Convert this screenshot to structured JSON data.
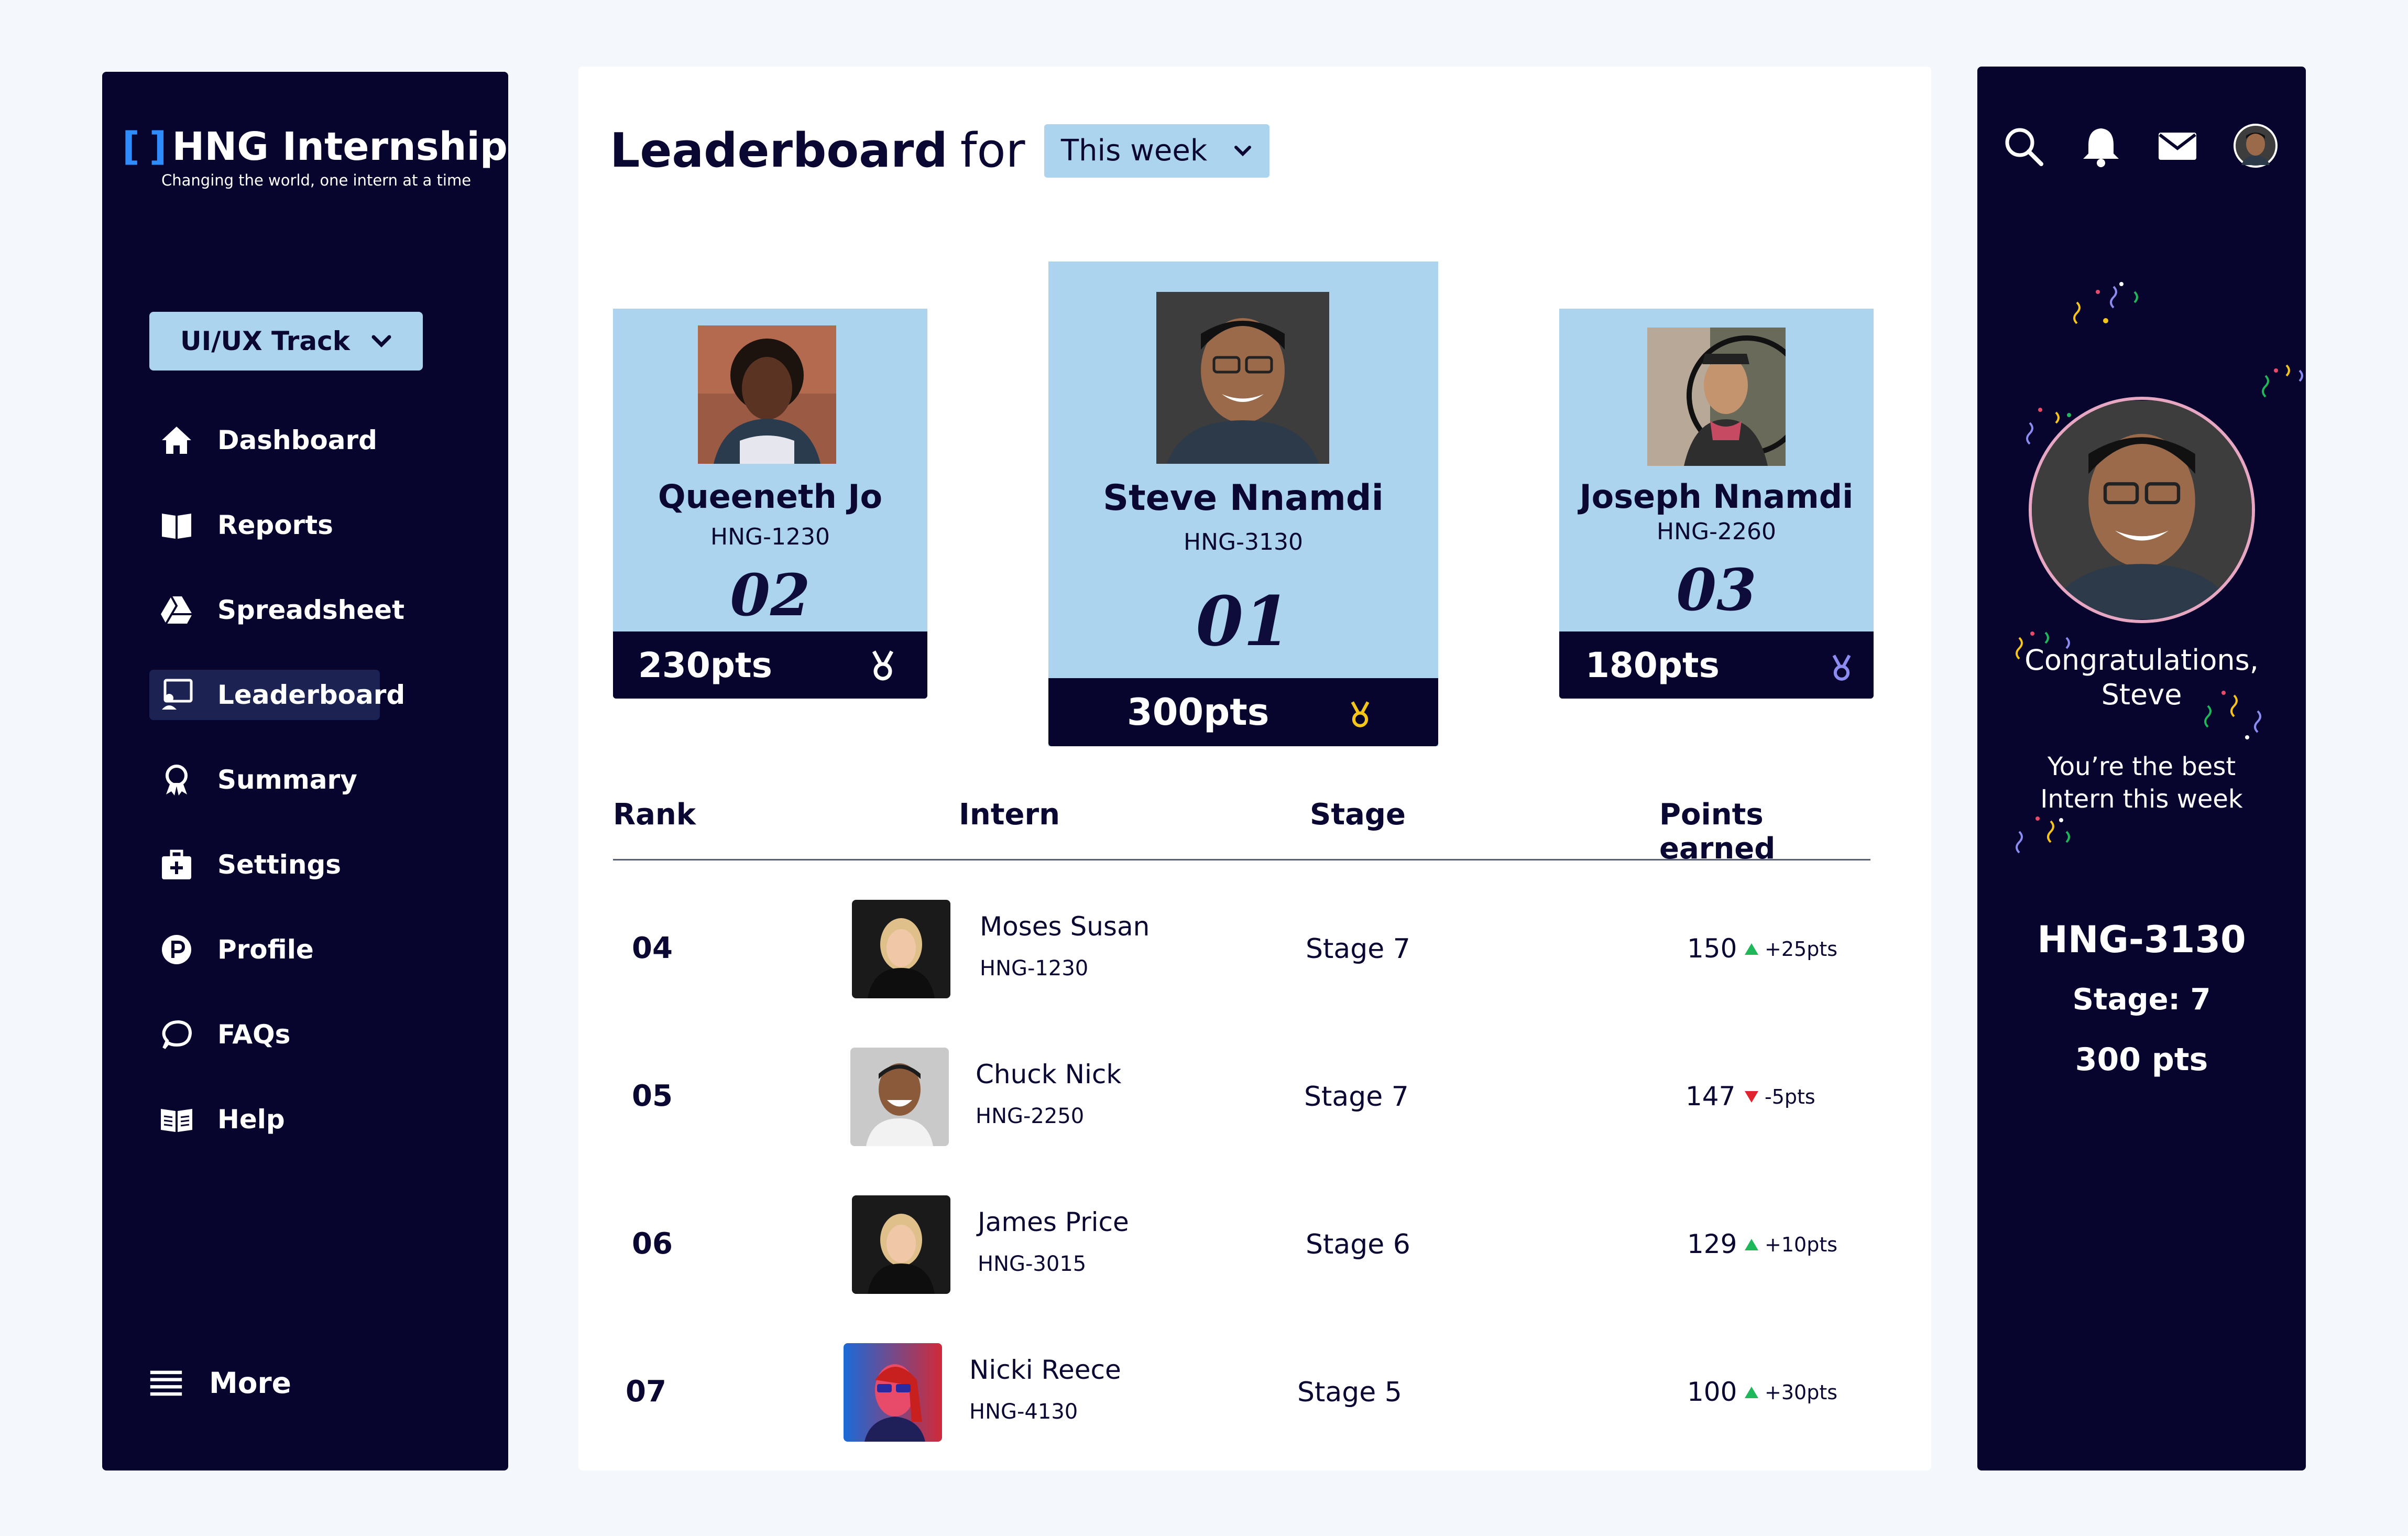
{
  "brand": {
    "title": "HNG Internship",
    "subtitle": "Changing the world, one intern at a time"
  },
  "track": {
    "label": "UI/UX Track"
  },
  "nav": [
    {
      "label": "Dashboard",
      "icon": "home-icon"
    },
    {
      "label": "Reports",
      "icon": "book-icon"
    },
    {
      "label": "Spreadsheet",
      "icon": "drive-icon"
    },
    {
      "label": "Leaderboard",
      "icon": "leaderboard-icon",
      "active": true
    },
    {
      "label": "Summary",
      "icon": "award-icon"
    },
    {
      "label": "Settings",
      "icon": "briefcase-icon"
    },
    {
      "label": "Profile",
      "icon": "profile-icon"
    },
    {
      "label": "FAQs",
      "icon": "chat-icon"
    },
    {
      "label": "Help",
      "icon": "help-book-icon"
    }
  ],
  "more": {
    "label": "More"
  },
  "leaderboard": {
    "title": "Leaderboard",
    "for": "for",
    "period": "This week"
  },
  "podium": {
    "first": {
      "name": "Steve Nnamdi",
      "id": "HNG-3130",
      "rank": "01",
      "points": "300pts"
    },
    "second": {
      "name": "Queeneth Jo",
      "id": "HNG-1230",
      "rank": "02",
      "points": "230pts"
    },
    "third": {
      "name": "Joseph Nnamdi",
      "id": "HNG-2260",
      "rank": "03",
      "points": "180pts"
    }
  },
  "table": {
    "headers": {
      "rank": "Rank",
      "intern": "Intern",
      "stage": "Stage",
      "points": "Points earned"
    },
    "rows": [
      {
        "rank": "04",
        "name": "Moses Susan",
        "id": "HNG-1230",
        "stage": "Stage 7",
        "points": "150",
        "delta": "+25pts",
        "trend": "up"
      },
      {
        "rank": "05",
        "name": "Chuck Nick",
        "id": "HNG-2250",
        "stage": "Stage 7",
        "points": "147",
        "delta": "-5pts",
        "trend": "down"
      },
      {
        "rank": "06",
        "name": "James Price",
        "id": "HNG-3015",
        "stage": "Stage 6",
        "points": "129",
        "delta": "+10pts",
        "trend": "up"
      },
      {
        "rank": "07",
        "name": "Nicki Reece",
        "id": "HNG-4130",
        "stage": "Stage 5",
        "points": "100",
        "delta": "+30pts",
        "trend": "up"
      }
    ]
  },
  "winner": {
    "congrats_line1": "Congratulations,",
    "congrats_line2": "Steve",
    "best_line1": "You’re the best",
    "best_line2": "Intern this week",
    "id": "HNG-3130",
    "stage": "Stage: 7",
    "points": "300 pts"
  },
  "colors": {
    "navy": "#07052e",
    "light_blue": "#acd4ee",
    "gold": "#f5c518",
    "silver": "#ffffff",
    "bronze": "#8c8cf0",
    "up": "#1eb85a",
    "down": "#e0232e"
  }
}
